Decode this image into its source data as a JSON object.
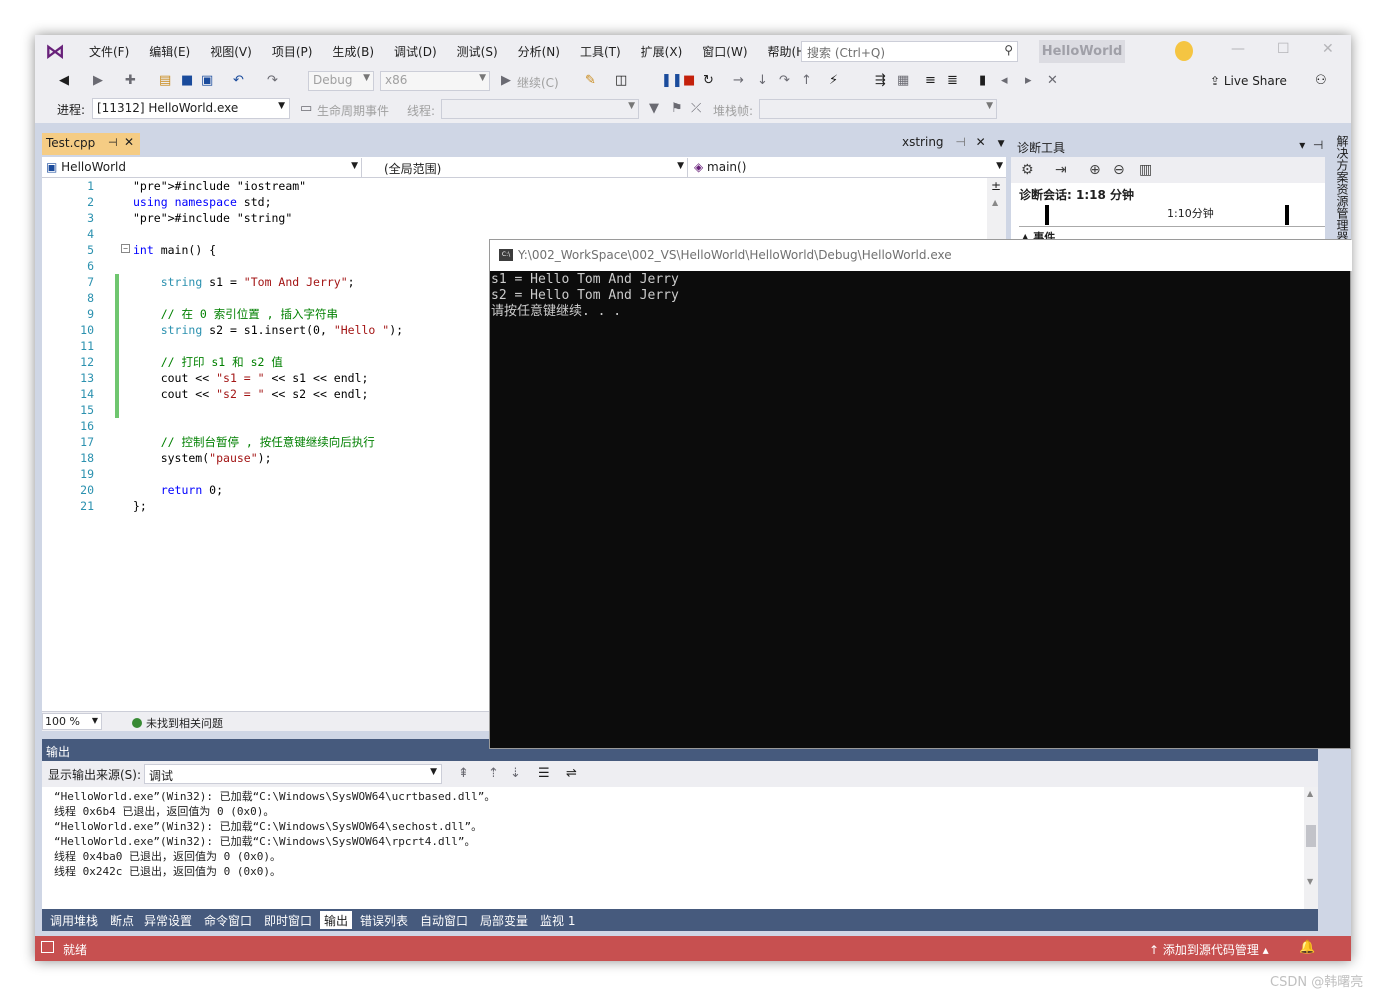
{
  "menu": [
    "文件(F)",
    "编辑(E)",
    "视图(V)",
    "项目(P)",
    "生成(B)",
    "调试(D)",
    "测试(S)",
    "分析(N)",
    "工具(T)",
    "扩展(X)",
    "窗口(W)",
    "帮助(H)"
  ],
  "search": {
    "placeholder": "搜索 (Ctrl+Q)"
  },
  "solution_title": "HelloWorld",
  "toolbar": {
    "config": "Debug",
    "platform": "x86",
    "continue": "继续(C)",
    "live_share": "Live Share"
  },
  "debug_toolbar": {
    "process_label": "进程:",
    "process_value": "[11312] HelloWorld.exe",
    "lifecycle": "生命周期事件",
    "thread_label": "线程:",
    "stack_label": "堆栈帧:"
  },
  "editor": {
    "active_tab": "Test.cpp",
    "right_tab": "xstring",
    "nav_project": "HelloWorld",
    "nav_scope": "(全局范围)",
    "nav_member": "main()",
    "zoom": "100 %",
    "issues": "未找到相关问题",
    "lines": [
      {
        "n": "1",
        "t": "#include \"iostream\""
      },
      {
        "n": "2",
        "t": "using namespace std;"
      },
      {
        "n": "3",
        "t": "#include \"string\""
      },
      {
        "n": "4",
        "t": ""
      },
      {
        "n": "5",
        "t": "int main() {"
      },
      {
        "n": "6",
        "t": ""
      },
      {
        "n": "7",
        "t": "    string s1 = \"Tom And Jerry\";"
      },
      {
        "n": "8",
        "t": ""
      },
      {
        "n": "9",
        "t": "    // 在 0 索引位置 , 插入字符串"
      },
      {
        "n": "10",
        "t": "    string s2 = s1.insert(0, \"Hello \");"
      },
      {
        "n": "11",
        "t": ""
      },
      {
        "n": "12",
        "t": "    // 打印 s1 和 s2 值"
      },
      {
        "n": "13",
        "t": "    cout << \"s1 = \" << s1 << endl;"
      },
      {
        "n": "14",
        "t": "    cout << \"s2 = \" << s2 << endl;"
      },
      {
        "n": "15",
        "t": ""
      },
      {
        "n": "16",
        "t": ""
      },
      {
        "n": "17",
        "t": "    // 控制台暂停 , 按任意键继续向后执行"
      },
      {
        "n": "18",
        "t": "    system(\"pause\");"
      },
      {
        "n": "19",
        "t": ""
      },
      {
        "n": "20",
        "t": "    return 0;"
      },
      {
        "n": "21",
        "t": "};"
      }
    ]
  },
  "diag": {
    "title": "诊断工具",
    "session": "诊断会话: 1:18 分钟",
    "timeline_mark": "1:10分钟",
    "events": "▲ 事件",
    "side_rail": "解决方案资源管理器"
  },
  "console": {
    "title": "Y:\\002_WorkSpace\\002_VS\\HelloWorld\\HelloWorld\\Debug\\HelloWorld.exe",
    "lines": [
      "s1 = Hello Tom And Jerry",
      "s2 = Hello Tom And Jerry",
      "请按任意键继续. . ."
    ]
  },
  "output": {
    "title": "输出",
    "source_label": "显示输出来源(S):",
    "source_value": "调试",
    "lines": [
      "“HelloWorld.exe”(Win32): 已加载“C:\\Windows\\SysWOW64\\ucrtbased.dll”。",
      "线程 0x6b4 已退出，返回值为 0 (0x0)。",
      "“HelloWorld.exe”(Win32): 已加载“C:\\Windows\\SysWOW64\\sechost.dll”。",
      "“HelloWorld.exe”(Win32): 已加载“C:\\Windows\\SysWOW64\\rpcrt4.dll”。",
      "线程 0x4ba0 已退出，返回值为 0 (0x0)。",
      "线程 0x242c 已退出，返回值为 0 (0x0)。"
    ]
  },
  "bottom_tabs": [
    "调用堆栈",
    "断点",
    "异常设置",
    "命令窗口",
    "即时窗口",
    "输出",
    "错误列表",
    "自动窗口",
    "局部变量",
    "监视 1"
  ],
  "status": {
    "left": "就绪",
    "right": "↑ 添加到源代码管理 ▴"
  },
  "watermark": "CSDN @韩曙亮",
  "colors": {
    "status_bar": "#c75050",
    "tab_active": "#f5cc84",
    "panel_title": "#465a7d"
  }
}
